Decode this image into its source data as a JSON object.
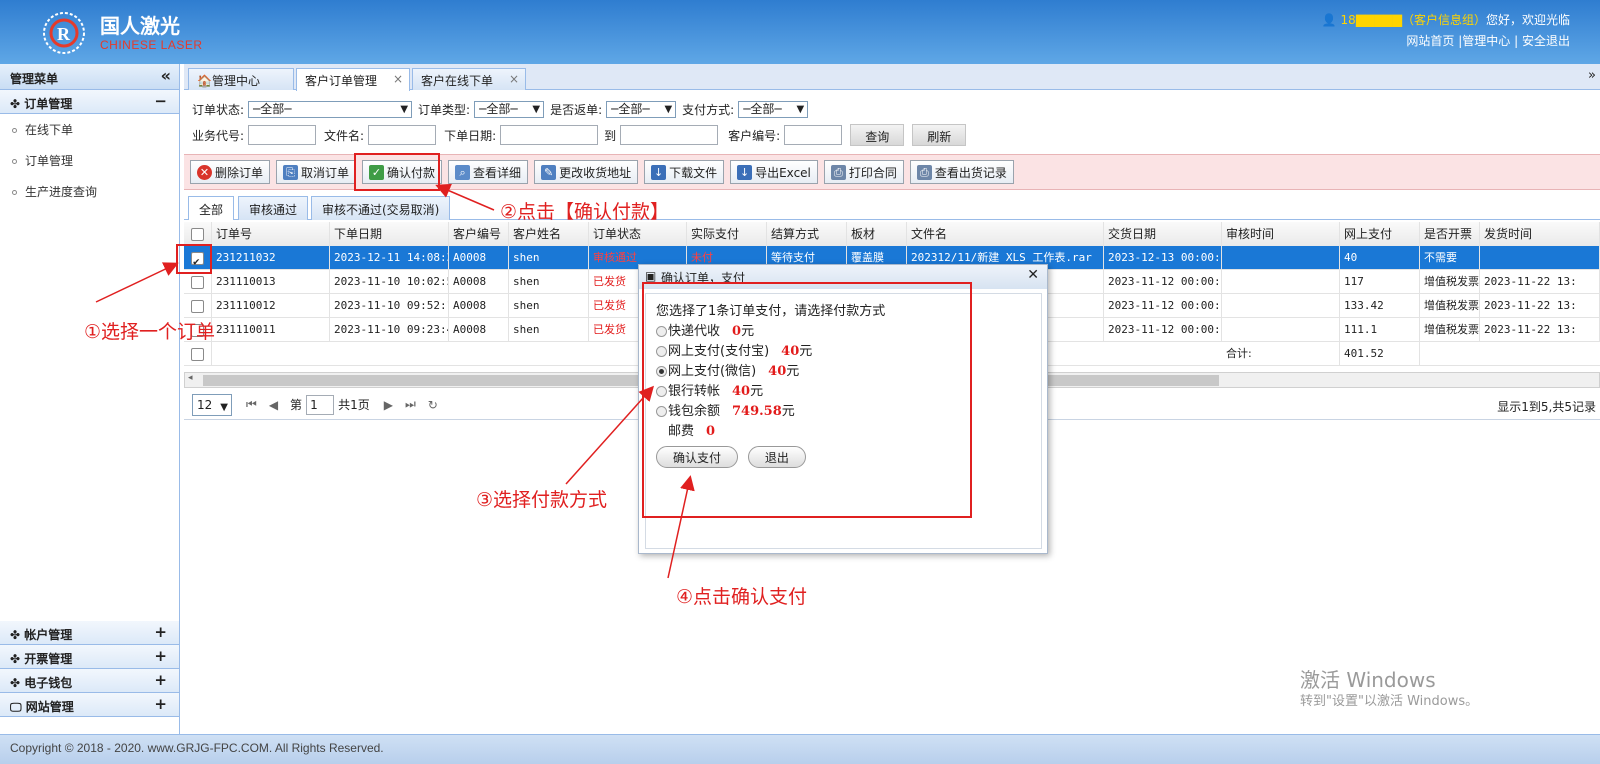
{
  "header": {
    "logo_cn": "国人激光",
    "logo_en": "CHINESE LASER",
    "user_id": "18",
    "user_role": "（客户信息组）",
    "greeting": "您好，欢迎光临",
    "links": [
      "网站首页",
      "管理中心",
      "安全退出"
    ]
  },
  "sidebar": {
    "title": "管理菜单",
    "collapse_icon": "«",
    "groups": [
      {
        "label": "订单管理",
        "sign": "−",
        "items": [
          "在线下单",
          "订单管理",
          "生产进度查询"
        ]
      },
      {
        "label": "帐户管理",
        "sign": "+"
      },
      {
        "label": "开票管理",
        "sign": "+"
      },
      {
        "label": "电子钱包",
        "sign": "+"
      },
      {
        "label": "网站管理",
        "sign": "+"
      }
    ]
  },
  "tabs": [
    {
      "label": "管理中心"
    },
    {
      "label": "客户订单管理",
      "close": "×"
    },
    {
      "label": "客户在线下单",
      "close": "×"
    }
  ],
  "filters": {
    "order_status_label": "订单状态:",
    "order_status_value": "─全部─",
    "order_type_label": "订单类型:",
    "order_type_value": "─全部─",
    "rebate_label": "是否返单:",
    "rebate_value": "─全部─",
    "pay_label": "支付方式:",
    "pay_value": "─全部─",
    "agent_label": "业务代号:",
    "filename_label": "文件名:",
    "date_label": "下单日期:",
    "to_label": "到",
    "custno_label": "客户编号:",
    "query": "查询",
    "refresh": "刷新"
  },
  "toolbar": [
    "删除订单",
    "取消订单",
    "确认付款",
    "查看详细",
    "更改收货地址",
    "下载文件",
    "导出Excel",
    "打印合同",
    "查看出货记录"
  ],
  "subtabs": [
    "全部",
    "审核通过",
    "审核不通过(交易取消)"
  ],
  "grid": {
    "columns": [
      "订单号",
      "下单日期",
      "客户编号",
      "客户姓名",
      "订单状态",
      "实际支付",
      "结算方式",
      "板材",
      "文件名",
      "交货日期",
      "审核时间",
      "网上支付",
      "是否开票",
      "发货时间"
    ],
    "rows": [
      {
        "order": "231211032",
        "date": "2023-12-11 14:08:30",
        "cust": "A0008",
        "name": "shen",
        "status": "审核通过",
        "paid": "未付",
        "settle": "等待支付",
        "board": "覆盖膜",
        "file": "202312/11/新建 XLS 工作表.rar",
        "delivery": "2023-12-13 00:00:00",
        "audit": "",
        "online": "40",
        "invoice": "不需要",
        "ship": ""
      },
      {
        "order": "231110013",
        "date": "2023-11-10 10:02:51",
        "cust": "A0008",
        "name": "shen",
        "status": "已发货",
        "paid": "",
        "settle": "",
        "board": "",
        "file": "",
        "delivery": "2023-11-12 00:00:00",
        "audit": "",
        "online": "117",
        "invoice": "增值税发票",
        "ship": "2023-11-22 13:"
      },
      {
        "order": "231110012",
        "date": "2023-11-10 09:52:13",
        "cust": "A0008",
        "name": "shen",
        "status": "已发货",
        "paid": "",
        "settle": "",
        "board": "",
        "file": "",
        "delivery": "2023-11-12 00:00:00",
        "audit": "",
        "online": "133.42",
        "invoice": "增值税发票",
        "ship": "2023-11-22 13:"
      },
      {
        "order": "231110011",
        "date": "2023-11-10 09:23:42",
        "cust": "A0008",
        "name": "shen",
        "status": "已发货",
        "paid": "",
        "settle": "",
        "board": "",
        "file": "",
        "delivery": "2023-11-12 00:00:00",
        "audit": "",
        "online": "111.1",
        "invoice": "增值税发票",
        "ship": "2023-11-22 13:"
      }
    ],
    "total_label": "合计:",
    "total_value": "401.52"
  },
  "pager": {
    "page_size": "12",
    "page_prefix": "第",
    "page": "1",
    "page_total": "共1页",
    "summary": "显示1到5,共5记录"
  },
  "dialog": {
    "title": "确认订单，支付",
    "prompt": "您选择了1条订单支付，请选择付款方式",
    "options": [
      {
        "label": "快递代收",
        "amount": "0",
        "unit": "元",
        "selected": false
      },
      {
        "label": "网上支付(支付宝)",
        "amount": "40",
        "unit": "元",
        "selected": false
      },
      {
        "label": "网上支付(微信)",
        "amount": "40",
        "unit": "元",
        "selected": true
      },
      {
        "label": "银行转帐",
        "amount": "40",
        "unit": "元",
        "selected": false
      },
      {
        "label": "钱包余额",
        "amount": "749.58",
        "unit": "元",
        "selected": false
      }
    ],
    "postage_label": "邮费",
    "postage_value": "0",
    "confirm": "确认支付",
    "exit": "退出"
  },
  "annotations": {
    "step1": "①选择一个订单",
    "step2": "②点击【确认付款】",
    "step3": "③选择付款方式",
    "step4": "④点击确认支付"
  },
  "watermark": {
    "line1": "激活 Windows",
    "line2": "转到\"设置\"以激活 Windows。"
  },
  "footer": "Copyright © 2018 - 2020. www.GRJG-FPC.COM. All Rights Reserved.",
  "colors": {
    "accent": "#1a78d6",
    "annotation": "#e02020",
    "header": "#2f7dd0"
  }
}
